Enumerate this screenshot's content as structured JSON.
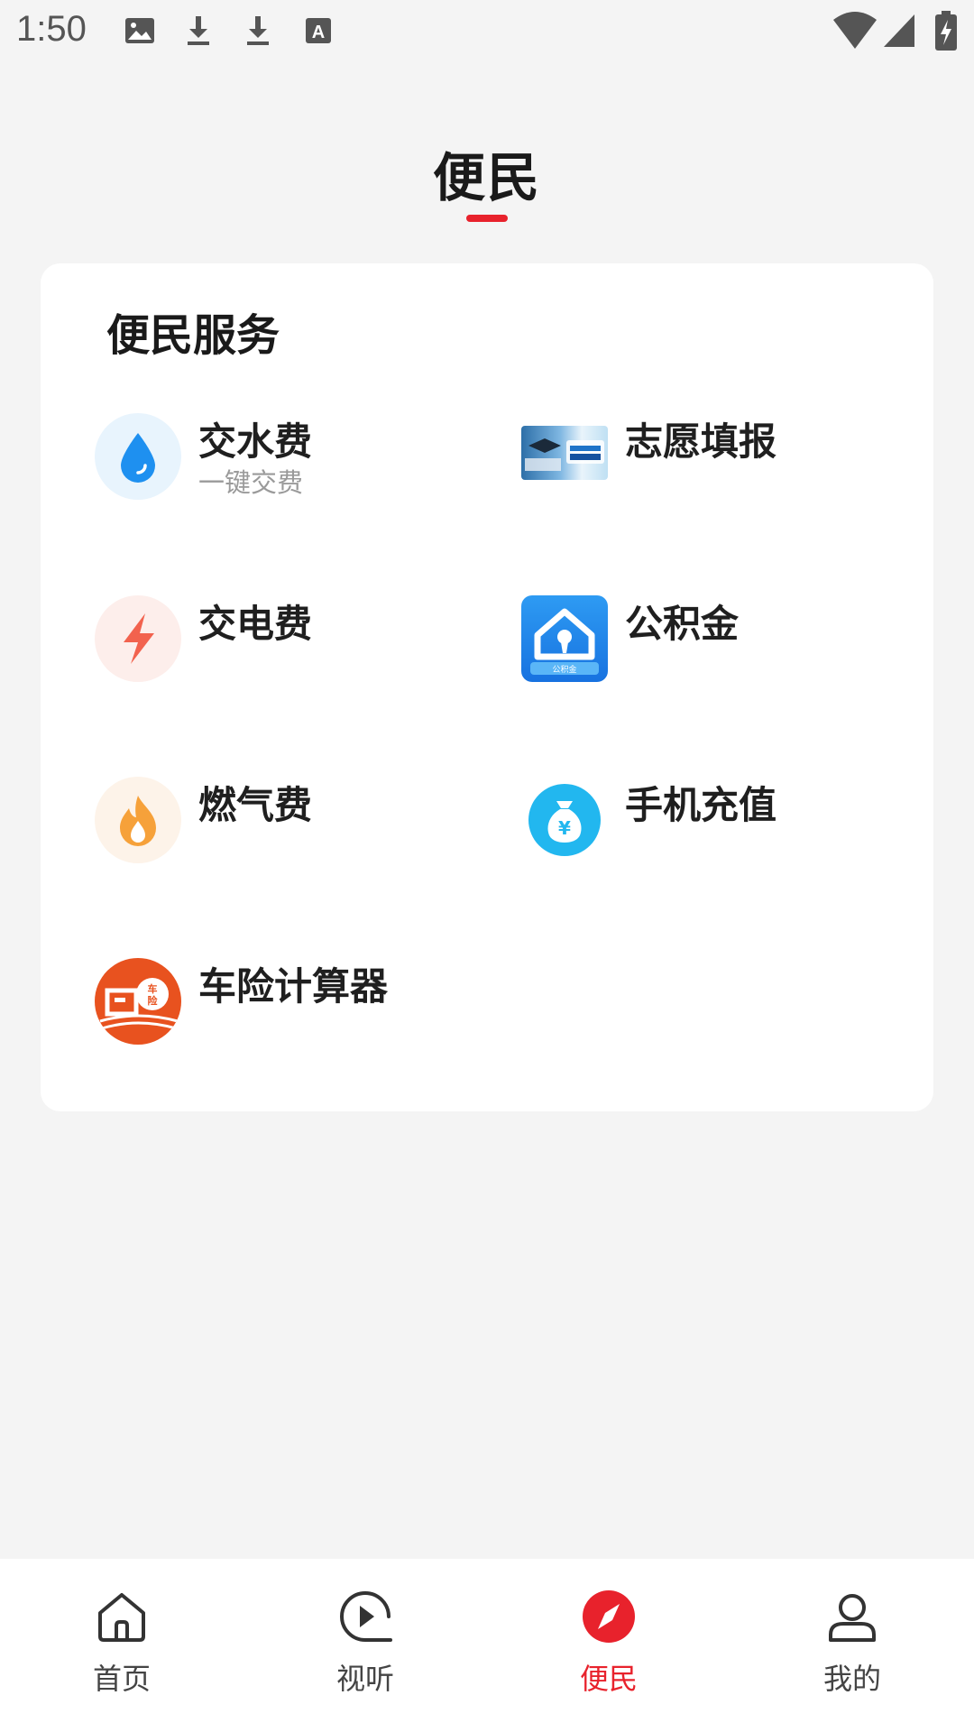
{
  "status_bar": {
    "time": "1:50",
    "left_icons": [
      "image-icon",
      "download-icon",
      "download-icon",
      "font-icon"
    ],
    "right_icons": [
      "wifi-icon",
      "signal-icon",
      "battery-charging-icon"
    ]
  },
  "header": {
    "title": "便民",
    "accent_color": "#e8222c"
  },
  "card": {
    "title": "便民服务",
    "services": [
      {
        "label": "交水费",
        "subtitle": "一键交费",
        "icon": "water-drop-icon"
      },
      {
        "label": "志愿填报",
        "icon": "college-application-banner-icon"
      },
      {
        "label": "交电费",
        "icon": "lightning-icon"
      },
      {
        "label": "公积金",
        "icon": "housing-fund-icon"
      },
      {
        "label": "燃气费",
        "icon": "flame-icon"
      },
      {
        "label": "手机充值",
        "icon": "money-bag-icon"
      },
      {
        "label": "车险计算器",
        "icon": "car-insurance-icon"
      }
    ]
  },
  "bottom_nav": {
    "items": [
      {
        "label": "首页",
        "icon": "home-icon",
        "active": false
      },
      {
        "label": "视听",
        "icon": "play-icon",
        "active": false
      },
      {
        "label": "便民",
        "icon": "compass-icon",
        "active": true
      },
      {
        "label": "我的",
        "icon": "user-icon",
        "active": false
      }
    ]
  }
}
